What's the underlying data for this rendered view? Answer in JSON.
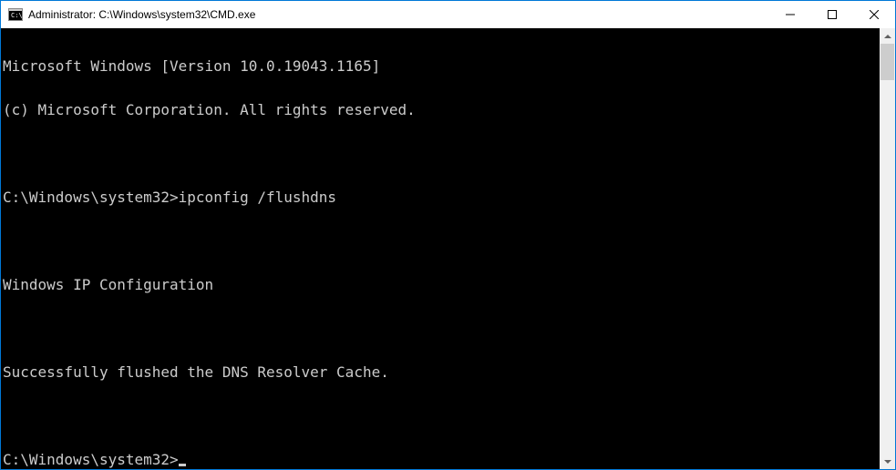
{
  "window": {
    "title": "Administrator: C:\\Windows\\system32\\CMD.exe"
  },
  "terminal": {
    "lines": [
      "Microsoft Windows [Version 10.0.19043.1165]",
      "(c) Microsoft Corporation. All rights reserved.",
      "",
      "C:\\Windows\\system32>ipconfig /flushdns",
      "",
      "Windows IP Configuration",
      "",
      "Successfully flushed the DNS Resolver Cache.",
      ""
    ],
    "prompt": "C:\\Windows\\system32>"
  }
}
